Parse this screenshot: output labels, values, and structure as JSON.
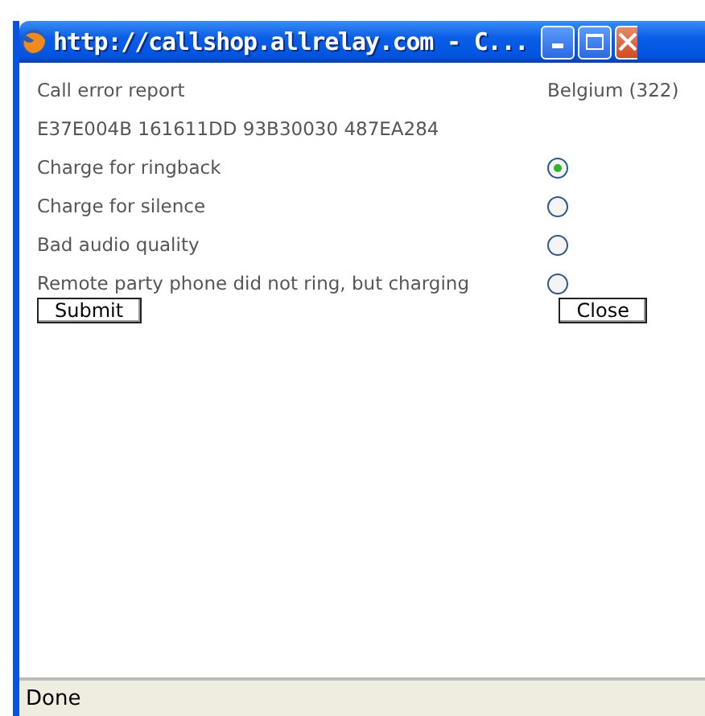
{
  "window": {
    "title": "http://callshop.allrelay.com - C..."
  },
  "report": {
    "heading": "Call error report",
    "country": "Belgium (322)",
    "call_id": "E37E004B 161611DD 93B30030 487EA284"
  },
  "options": [
    {
      "label": "Charge for ringback",
      "selected": true
    },
    {
      "label": "Charge for silence",
      "selected": false
    },
    {
      "label": "Bad audio quality",
      "selected": false
    },
    {
      "label": "Remote party phone did not ring, but charging",
      "selected": false
    }
  ],
  "buttons": {
    "submit": "Submit",
    "close": "Close"
  },
  "status_bar": "Done"
}
